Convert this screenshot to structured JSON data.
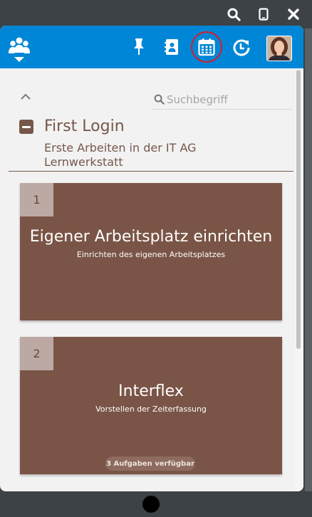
{
  "window_controls": [
    {
      "icon": "search-icon"
    },
    {
      "icon": "mobile-icon"
    },
    {
      "icon": "close-icon"
    }
  ],
  "header": {
    "background": "#0086d6",
    "logo_icon": "team-icon",
    "buttons": [
      {
        "icon": "pin-icon"
      },
      {
        "icon": "contacts-icon"
      },
      {
        "icon": "calendar-icon",
        "highlighted": true
      },
      {
        "icon": "history-icon"
      }
    ],
    "avatar_icon": "user-avatar"
  },
  "search": {
    "placeholder": "Suchbegriff",
    "value": ""
  },
  "section": {
    "title": "First Login",
    "subtitle": "Erste Arbeiten in der IT AG Lernwerkstatt"
  },
  "cards": [
    {
      "number": "1",
      "title": "Eigener Arbeitsplatz einrichten",
      "subtitle": "Einrichten des eigenen Arbeitsplatzes",
      "badge": ""
    },
    {
      "number": "2",
      "title": "Interflex",
      "subtitle": "Vorstellen der Zeiterfassung",
      "badge": "3 Aufgaben verfügbar"
    }
  ],
  "colors": {
    "brand_blue": "#0086d6",
    "card_brown": "#7a5446",
    "text_brown": "#77574b",
    "badge_bg": "#bca9a3",
    "highlight_red": "#d81b2b"
  }
}
